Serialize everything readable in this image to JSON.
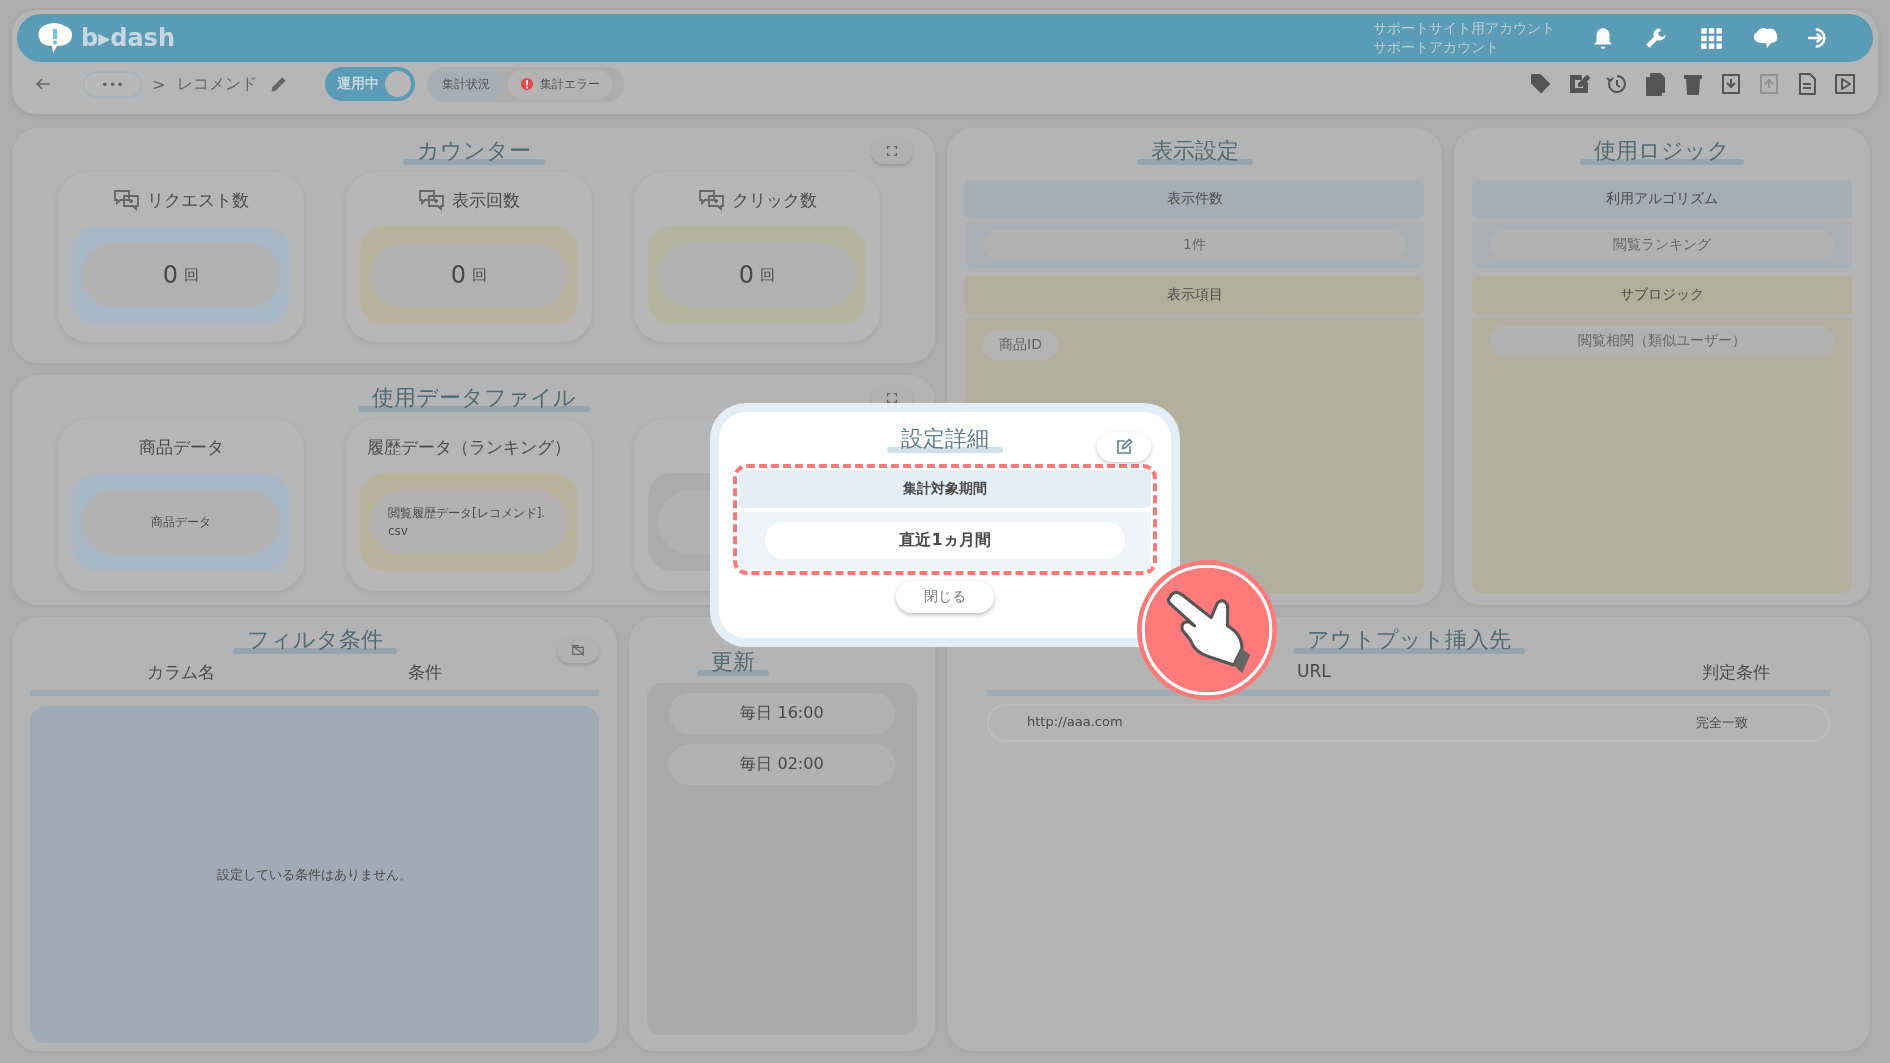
{
  "header": {
    "logo_text": "b▸dash",
    "account": [
      "サポートサイト用アカウント",
      "サポートアカウント"
    ]
  },
  "toolbar": {
    "more": "•••",
    "separator": ">",
    "title": "レコメンド",
    "toggle": {
      "label": "運用中",
      "on": true
    },
    "chips": [
      {
        "label": "集計状況",
        "kind": "plain"
      },
      {
        "label": "集計エラー",
        "kind": "error"
      }
    ],
    "actions": [
      {
        "disabled": false
      },
      {
        "disabled": false
      },
      {
        "disabled": false
      },
      {
        "disabled": false
      },
      {
        "disabled": false
      },
      {
        "disabled": false
      },
      {
        "disabled": true
      },
      {
        "disabled": false
      },
      {
        "disabled": false
      }
    ]
  },
  "counter": {
    "title": "カウンター",
    "cards": [
      {
        "label": "リクエスト数",
        "value": "0",
        "unit": "回",
        "color": "#a9b7c4"
      },
      {
        "label": "表示回数",
        "value": "0",
        "unit": "回",
        "color": "#bab39c"
      },
      {
        "label": "クリック数",
        "value": "0",
        "unit": "回",
        "color": "#b3b59e"
      }
    ]
  },
  "data_files": {
    "title": "使用データファイル",
    "cards": [
      {
        "title": "商品データ",
        "value": "商品データ",
        "color": "#a9b7c4"
      },
      {
        "title": "履歴データ（ランキング）",
        "value": "閲覧履歴データ[レコメンド].csv",
        "color": "#bab39c"
      },
      {
        "color": "#acacac"
      }
    ]
  },
  "display_settings": {
    "title": "表示設定",
    "sections": [
      {
        "header": "表示件数",
        "kind": "single",
        "color": "#a5aeb6",
        "items": [
          "1件"
        ]
      },
      {
        "header": "表示項目",
        "kind": "tags",
        "color": "#b3ae99",
        "items": [
          "商品ID"
        ]
      }
    ]
  },
  "logic": {
    "title": "使用ロジック",
    "sections": [
      {
        "header": "利用アルゴリズム",
        "kind": "single",
        "color": "#a5aeb6",
        "items": [
          "閲覧ランキング"
        ]
      },
      {
        "header": "サブロジック",
        "kind": "list",
        "color": "#b3ae99",
        "items": [
          "閲覧相関（類似ユーザー）"
        ]
      }
    ]
  },
  "filter": {
    "title": "フィルタ条件",
    "columns": [
      "カラム名",
      "条件"
    ],
    "empty_message": "設定している条件はありません。"
  },
  "schedule": {
    "title": "更新",
    "items": [
      "毎日 16:00",
      "毎日 02:00"
    ]
  },
  "output": {
    "title": "アウトプット挿入先",
    "columns": [
      "URL",
      "判定条件"
    ],
    "rows": [
      [
        "http://aaa.com",
        "完全一致"
      ]
    ]
  },
  "modal": {
    "title": "設定詳細",
    "highlighted": true,
    "label": "集計対象期間",
    "value": "直近1ヵ月間",
    "close": "閉じる"
  }
}
